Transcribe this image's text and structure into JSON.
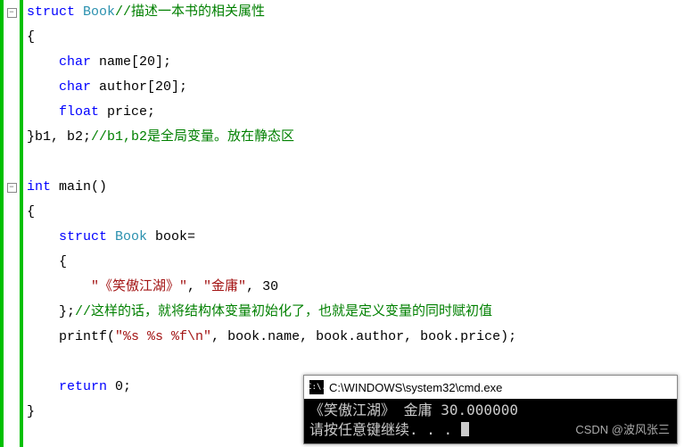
{
  "icons": {
    "fold": "−",
    "console": "C:\\."
  },
  "code": {
    "l1_kw": "struct",
    "l1_type": " Book",
    "l1_cmt": "//描述一本书的相关属性",
    "l2": "{",
    "l3_pre": "    ",
    "l3_kw": "char",
    "l3_rest": " name[20];",
    "l4_pre": "    ",
    "l4_kw": "char",
    "l4_rest": " author[20];",
    "l5_pre": "    ",
    "l5_kw": "float",
    "l5_rest": " price;",
    "l6_plain": "}b1, b2;",
    "l6_cmt": "//b1,b2是全局变量。放在静态区",
    "l7": "",
    "l8_kw": "int",
    "l8_rest": " main()",
    "l9": "{",
    "l10_pre": "    ",
    "l10_kw": "struct",
    "l10_type": " Book",
    "l10_rest": " book=",
    "l11": "    {",
    "l12_pre": "        ",
    "l12_str": "\"《笑傲江湖》\"",
    "l12_mid": ", ",
    "l12_str2": "\"金庸\"",
    "l12_rest": ", 30",
    "l13_plain": "    };",
    "l13_cmt": "//这样的话，就将结构体变量初始化了，也就是定义变量的同时赋初值",
    "l14_pre": "    printf(",
    "l14_str": "\"%s %s %f\\n\"",
    "l14_rest": ", book.name, book.author, book.price);",
    "l15": "",
    "l16_pre": "    ",
    "l16_kw": "return",
    "l16_rest": " 0;",
    "l17": "}"
  },
  "console": {
    "title": "C:\\WINDOWS\\system32\\cmd.exe",
    "line1": "《笑傲江湖》 金庸 30.000000",
    "line2": "请按任意键继续. . . ",
    "watermark": "CSDN @波风张三"
  }
}
